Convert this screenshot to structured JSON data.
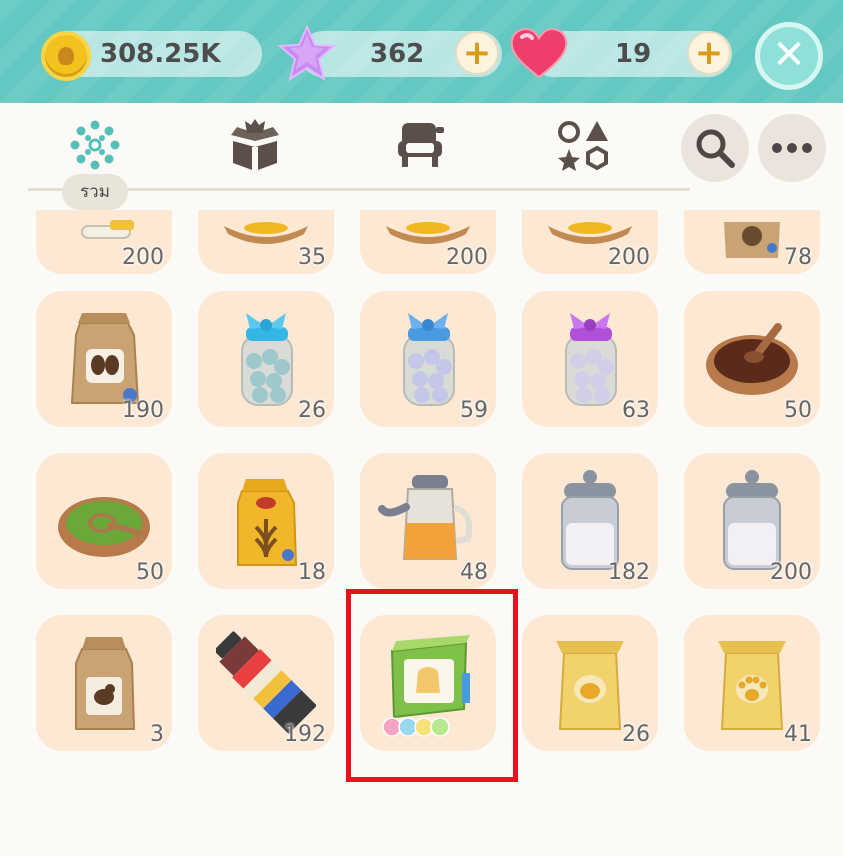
{
  "resources": {
    "coins": "308.25K",
    "stars": "362",
    "hearts": "19"
  },
  "tabs": [
    {
      "name": "all",
      "icon": "flower-icon",
      "label": "รวม"
    },
    {
      "name": "gift-box",
      "icon": "gift-box-icon"
    },
    {
      "name": "furniture",
      "icon": "armchair-icon"
    },
    {
      "name": "shapes",
      "icon": "shapes-icon"
    }
  ],
  "actions": {
    "search_icon": "search-icon",
    "more_icon": "more-icon"
  },
  "grid": {
    "row0": [
      "200",
      "35",
      "200",
      "200",
      "78"
    ],
    "row1": [
      "190",
      "26",
      "59",
      "63",
      "50"
    ],
    "row2": [
      "50",
      "18",
      "48",
      "182",
      "200"
    ],
    "row3": [
      "3",
      "192",
      "",
      "26",
      "41"
    ]
  },
  "colors": {
    "header": "#62c8c1",
    "cell": "#fde8d4",
    "highlight": "#e8101a",
    "plus": "#d99a18"
  }
}
